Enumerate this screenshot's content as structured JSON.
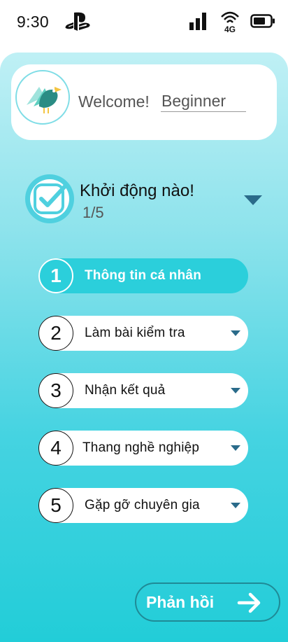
{
  "status_bar": {
    "time": "9:30",
    "icons": [
      "playstation-icon",
      "signal-icon",
      "4g-icon",
      "battery-icon"
    ],
    "network_label": "4G"
  },
  "welcome": {
    "greeting": "Welcome!",
    "username": "Beginner",
    "avatar_icon": "bird-icon"
  },
  "progress": {
    "title": "Khởi động nào!",
    "count": "1/5",
    "icon": "check-icon",
    "toggle_icon": "caret-down-icon"
  },
  "steps": [
    {
      "number": "1",
      "label": "Thông tin cá nhân",
      "active": true
    },
    {
      "number": "2",
      "label": "Làm bài kiểm tra",
      "active": false
    },
    {
      "number": "3",
      "label": "Nhận kết quả",
      "active": false
    },
    {
      "number": "4",
      "label": "Thang nghề nghiệp",
      "active": false
    },
    {
      "number": "5",
      "label": "Gặp gỡ chuyên gia",
      "active": false
    }
  ],
  "feedback": {
    "label": "Phản hồi",
    "icon": "arrow-right-icon"
  },
  "colors": {
    "accent": "#2bcfdb",
    "gradient_top": "#bff0f5",
    "gradient_bottom": "#22cdd8",
    "caret": "#2a6b8a",
    "feedback_border": "#1f8a96"
  }
}
